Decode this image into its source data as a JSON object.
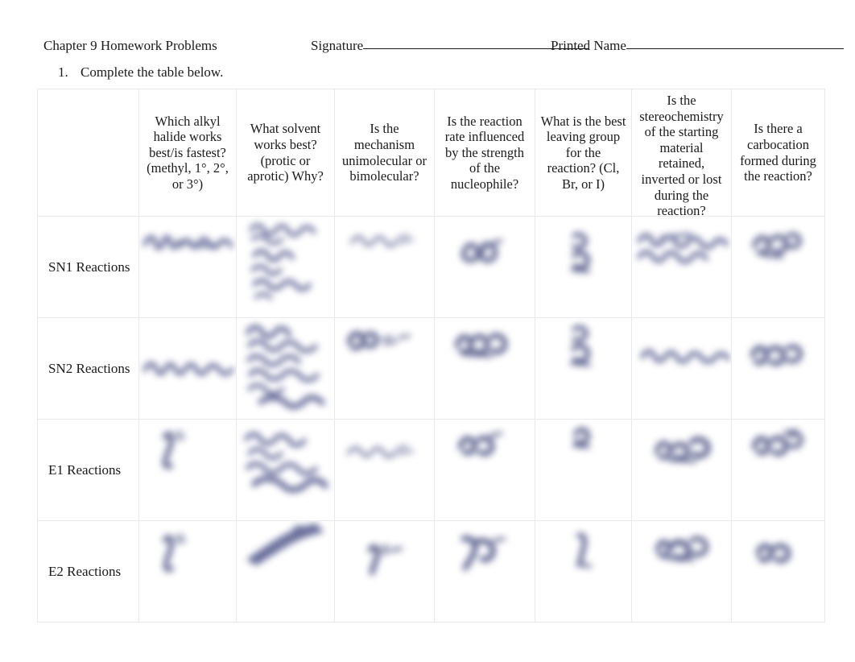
{
  "document": {
    "title": "Chapter 9 Homework Problems",
    "signature_label": "Signature",
    "printed_name_label": "Printed Name",
    "instruction_number": "1.",
    "instruction_text": "Complete the table below."
  },
  "table": {
    "headers": [
      "",
      "Which alkyl halide works best/is fastest? (methyl, 1°, 2°, or 3°)",
      "What solvent works best? (protic or aprotic) Why?",
      "Is the mechanism unimolecular or bimolecular?",
      "Is the reaction rate influenced by the strength of the nucleophile?",
      "What is the best leaving group for the reaction? (Cl, Br, or I)",
      "Is the stereochemistry of the starting material retained, inverted or lost during the reaction?",
      "Is there a carbocation formed during the reaction?"
    ],
    "row_labels": [
      "SN1 Reactions",
      "SN2 Reactions",
      "E1 Reactions",
      "E2 Reactions"
    ],
    "answers_state": "handwritten-blurred"
  },
  "colors": {
    "page_background": "#ffffff",
    "text": "#1a1a1a",
    "table_border": "#e9e9ed",
    "handwriting_ink": "#4a5086"
  }
}
